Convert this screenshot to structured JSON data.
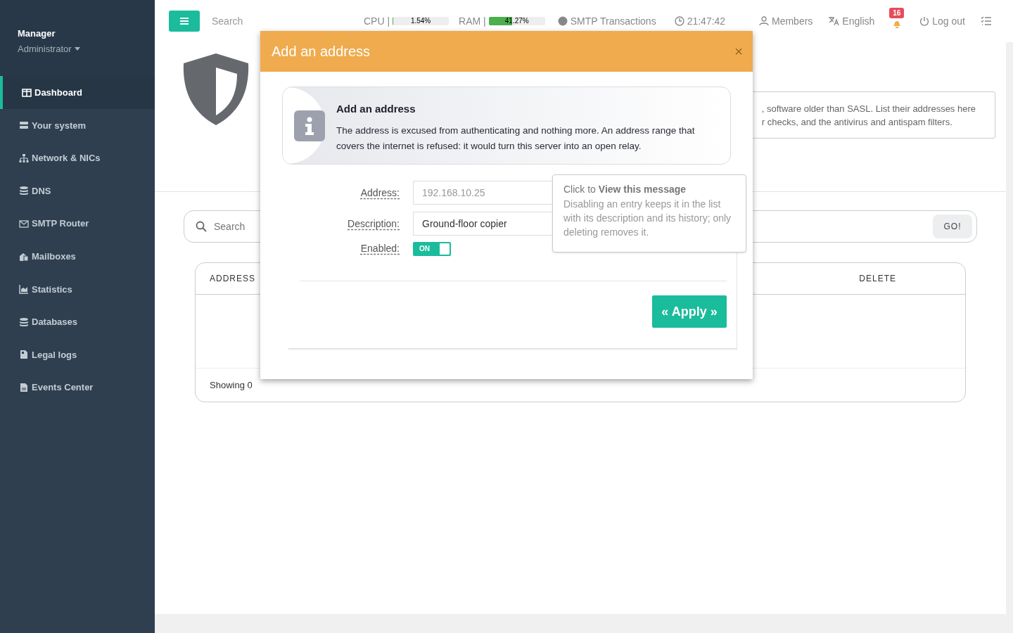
{
  "sidebar": {
    "user": "Manager",
    "role": "Administrator",
    "items": [
      {
        "label": "Dashboard",
        "selected": true
      },
      {
        "label": "Your system",
        "selected": false
      },
      {
        "label": "Network & NICs",
        "selected": false
      },
      {
        "label": "DNS",
        "selected": false
      },
      {
        "label": "SMTP Router",
        "selected": false
      },
      {
        "label": "Mailboxes",
        "selected": false
      },
      {
        "label": "Statistics",
        "selected": false
      },
      {
        "label": "Databases",
        "selected": false
      },
      {
        "label": "Legal logs",
        "selected": false
      },
      {
        "label": "Events Center",
        "selected": false
      }
    ]
  },
  "topbar": {
    "search": {
      "placeholder": "Search"
    },
    "cpu": {
      "label": "CPU |",
      "reading": "1.54%",
      "level": 0.0154
    },
    "ram": {
      "label": "RAM |",
      "reading": "41.27%",
      "level": 0.4127
    },
    "smtp": "SMTP Transactions",
    "time": "21:47:42",
    "members": "Members",
    "language": "English",
    "notifications": "16",
    "logout": "Log out"
  },
  "page": {
    "description": ", software older than SASL. List their addresses here\nr checks, and the antivirus and antispam filters.",
    "search": {
      "placeholder": "Search",
      "button": "GO!"
    },
    "table": {
      "columns": [
        "ADDRESS",
        "DELETE"
      ],
      "footer": "Showing 0"
    }
  },
  "modal": {
    "title": "Add an address",
    "close": "×",
    "callout": {
      "title": "Add an address",
      "text": "The address is excused from authenticating and nothing more. An address range that covers the internet is refused: it would turn this server into an open relay."
    },
    "fields": [
      {
        "label": "Address:",
        "kind": "text",
        "placeholder": "192.168.10.25"
      },
      {
        "label": "Description:",
        "kind": "text",
        "value": "Ground-floor copier"
      },
      {
        "label": "Enabled:",
        "kind": "toggle",
        "on": true,
        "text": "ON"
      }
    ],
    "apply": "« Apply »",
    "tooltip": {
      "title": "Click to **View this message**",
      "text": "Disabling an entry keeps it in the list with its description and its history; only deleting removes it."
    }
  }
}
